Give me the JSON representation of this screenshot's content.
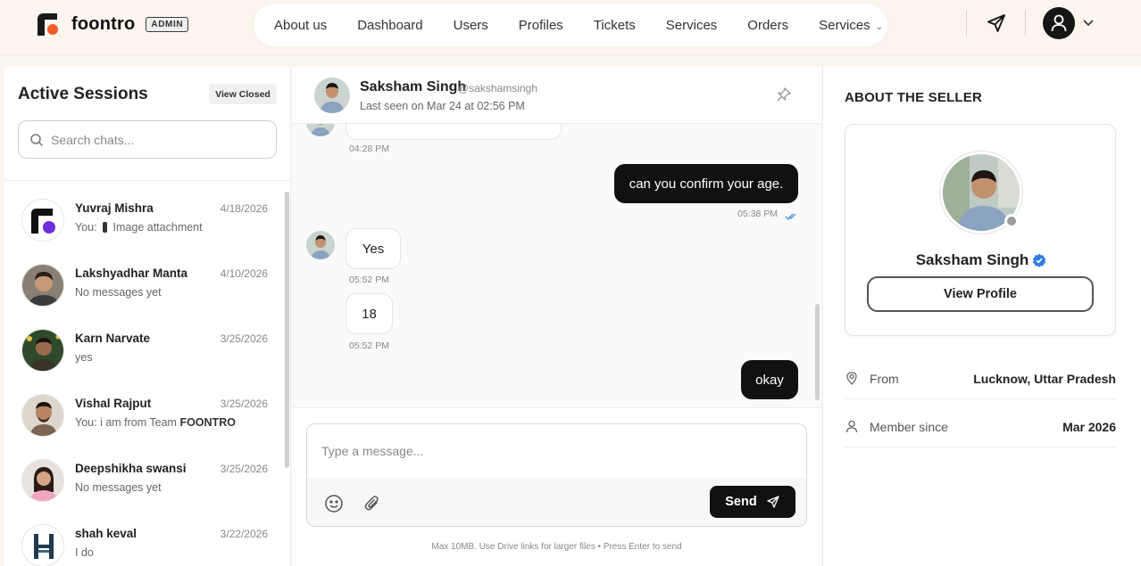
{
  "brand": {
    "name": "foontro",
    "badge": "ADMIN",
    "logo_color": "#1a1a1a",
    "logo_accent": "#f25c2a"
  },
  "nav": {
    "items": [
      "About us",
      "Dashboard",
      "Users",
      "Profiles",
      "Tickets",
      "Services",
      "Orders",
      "Services"
    ],
    "dropdown_caret": "chevron-down"
  },
  "sessions": {
    "title": "Active Sessions",
    "view_closed": "View Closed",
    "search_placeholder": "Search chats...",
    "items": [
      {
        "name": "Yuvraj Mishra",
        "date": "4/18/2026",
        "preview_prefix": "You:",
        "preview": "Image attachment"
      },
      {
        "name": "Lakshyadhar Manta",
        "date": "4/10/2026",
        "preview": "No messages yet"
      },
      {
        "name": "Karn Narvate",
        "date": "3/25/2026",
        "preview": "yes"
      },
      {
        "name": "Vishal Rajput",
        "date": "3/25/2026",
        "preview_prefix": "You:",
        "preview": "i am from Team",
        "preview_brand": "FOONTRO"
      },
      {
        "name": "Deepshikha swansi",
        "date": "3/25/2026",
        "preview": "No messages yet"
      },
      {
        "name": "shah keval",
        "date": "3/22/2026",
        "preview": "I do"
      }
    ]
  },
  "chat": {
    "name": "Saksham Singh",
    "handle": "@sakshamsingh",
    "last_seen": "Last seen on Mar 24 at 02:56 PM",
    "messages": [
      {
        "dir": "in",
        "text": "",
        "time": "04:28 PM"
      },
      {
        "dir": "out",
        "text": "can you confirm your age.",
        "time": "05:38 PM"
      },
      {
        "dir": "in",
        "text": "Yes",
        "time": "05:52 PM"
      },
      {
        "dir": "in",
        "text": "18",
        "time": "05:52 PM"
      },
      {
        "dir": "out",
        "text": "okay",
        "time": ""
      }
    ],
    "composer_placeholder": "Type a message...",
    "send_label": "Send",
    "hint": "Max 10MB. Use Drive links for larger files • Press Enter to send"
  },
  "seller": {
    "section_title": "ABOUT THE SELLER",
    "name": "Saksham Singh",
    "view_profile": "View Profile",
    "from_label": "From",
    "from_value": "Lucknow, Uttar Pradesh",
    "member_label": "Member since",
    "member_value": "Mar 2026",
    "verified_color": "#2f7de1"
  }
}
